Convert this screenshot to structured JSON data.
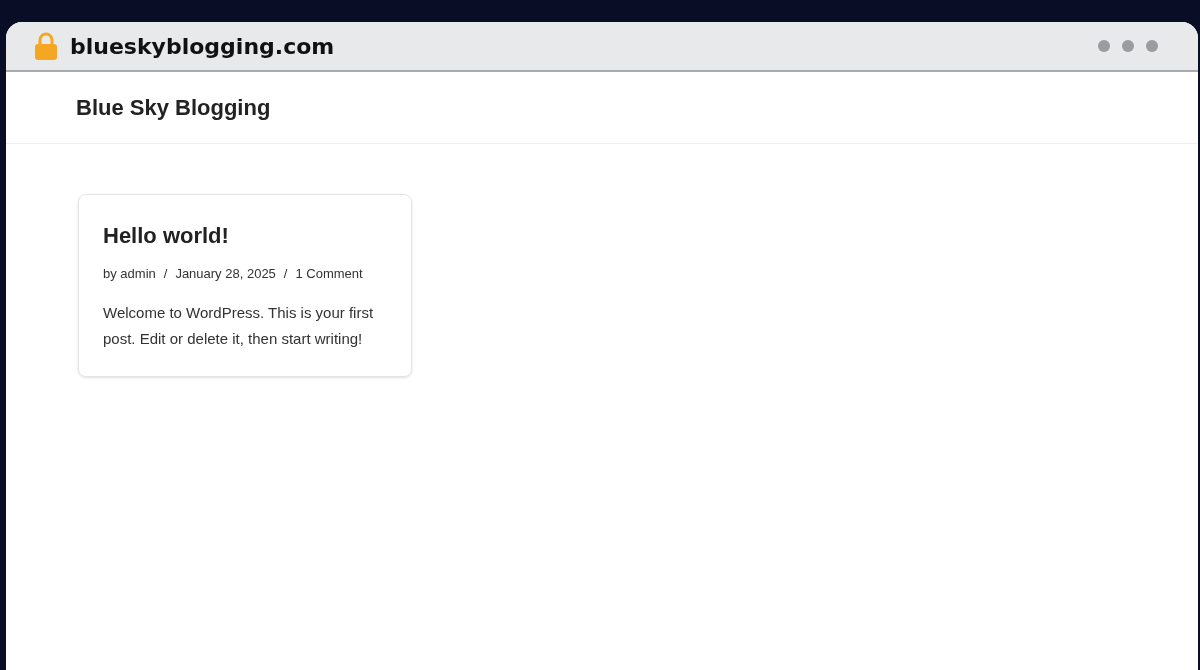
{
  "browser": {
    "url": "blueskyblogging.com"
  },
  "site": {
    "title": "Blue Sky Blogging"
  },
  "posts": [
    {
      "title": "Hello world!",
      "meta": [
        "by admin",
        "January 28, 2025",
        "1 Comment"
      ],
      "separator": "/",
      "excerpt": "Welcome to WordPress. This is your first post. Edit or delete it, then start writing!"
    }
  ]
}
